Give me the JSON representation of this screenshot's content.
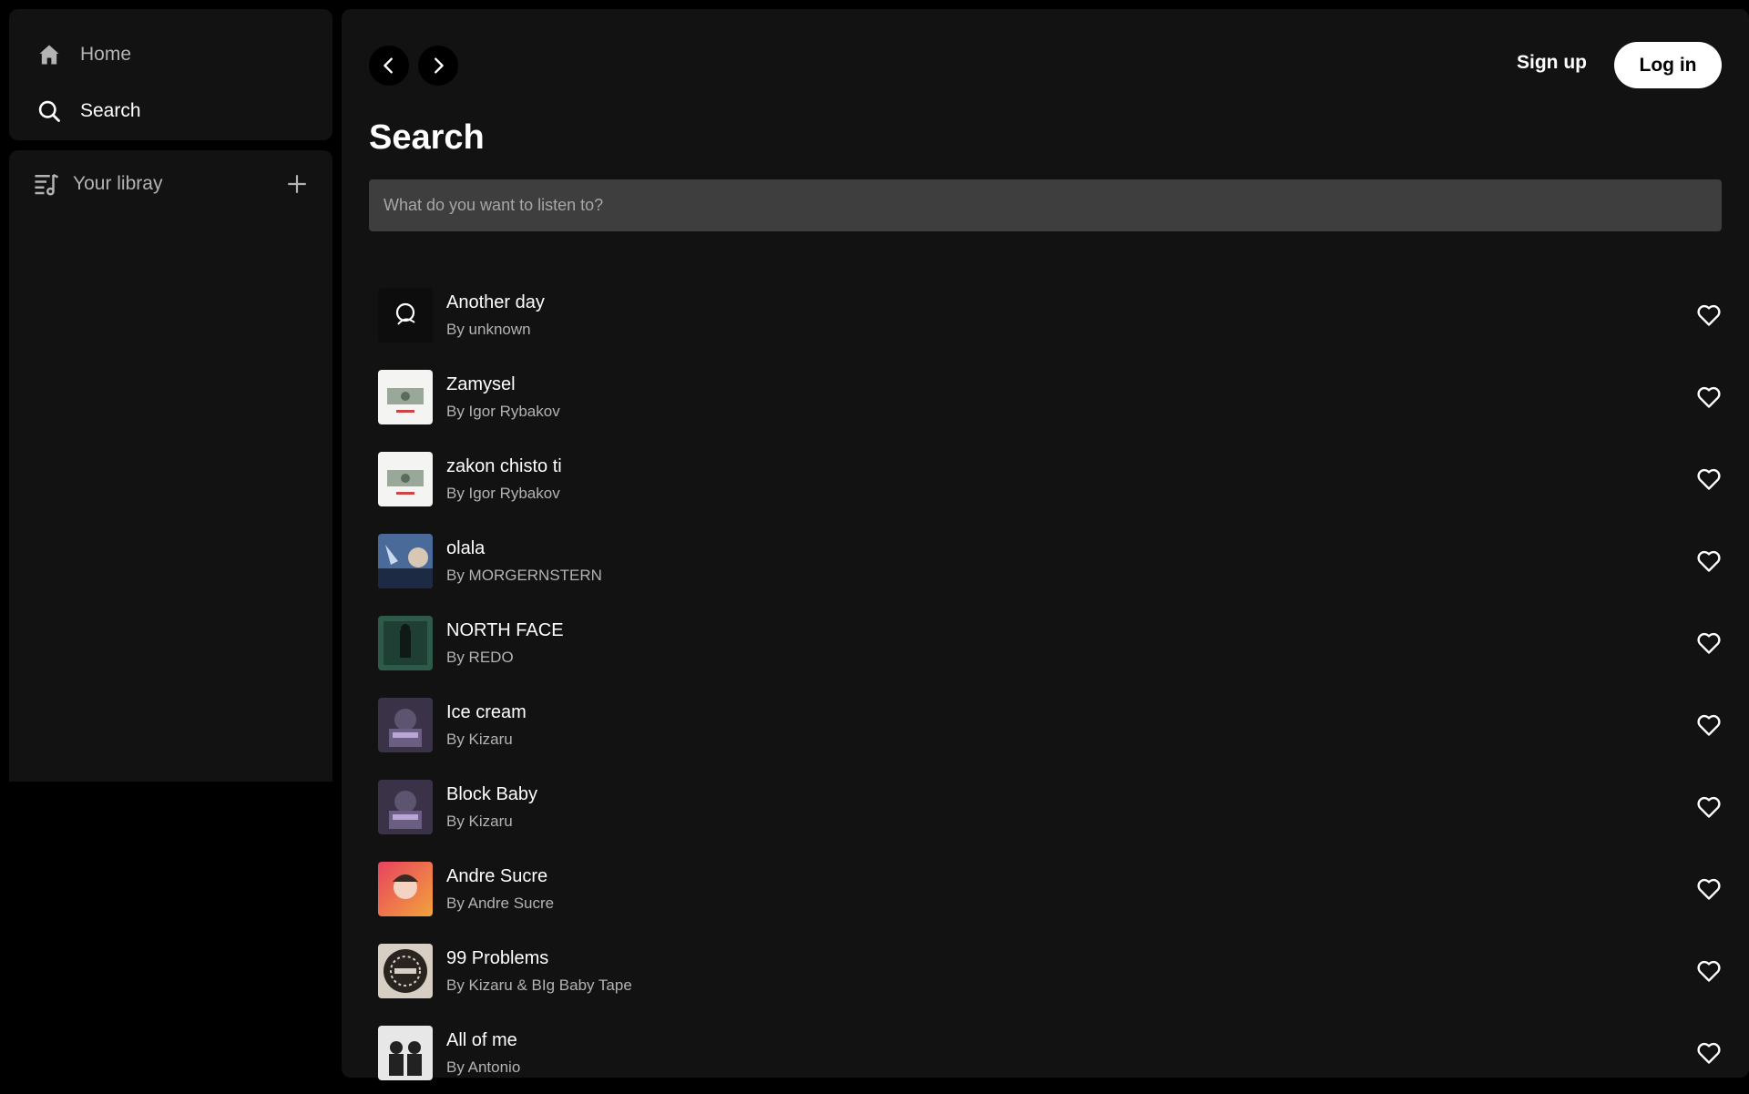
{
  "sidebar": {
    "home_label": "Home",
    "search_label": "Search",
    "library_label": "Your libray"
  },
  "header": {
    "signup_label": "Sign up",
    "login_label": "Log in"
  },
  "page": {
    "title": "Search",
    "search_placeholder": "What do you want to listen to?"
  },
  "tracks": [
    {
      "title": "Another day",
      "artist": "By unknown"
    },
    {
      "title": "Zamysel",
      "artist": "By Igor Rybakov"
    },
    {
      "title": "zakon chisto ti",
      "artist": "By Igor Rybakov"
    },
    {
      "title": "olala",
      "artist": "By MORGERNSTERN"
    },
    {
      "title": "NORTH FACE",
      "artist": "By REDO"
    },
    {
      "title": "Ice cream",
      "artist": "By Kizaru"
    },
    {
      "title": "Block Baby",
      "artist": "By Kizaru"
    },
    {
      "title": "Andre Sucre",
      "artist": "By Andre Sucre"
    },
    {
      "title": "99 Problems",
      "artist": "By Kizaru & BIg Baby Tape"
    },
    {
      "title": "All of me",
      "artist": "By Antonio"
    }
  ],
  "colors": {
    "background": "#000000",
    "panel": "#121212",
    "input": "#3e3e3e",
    "text_muted": "#b3b3b3"
  },
  "icons": {
    "home": "home-icon",
    "search": "search-icon",
    "library": "library-icon",
    "add": "plus-icon",
    "back": "chevron-left-icon",
    "forward": "chevron-right-icon",
    "like": "heart-icon"
  }
}
